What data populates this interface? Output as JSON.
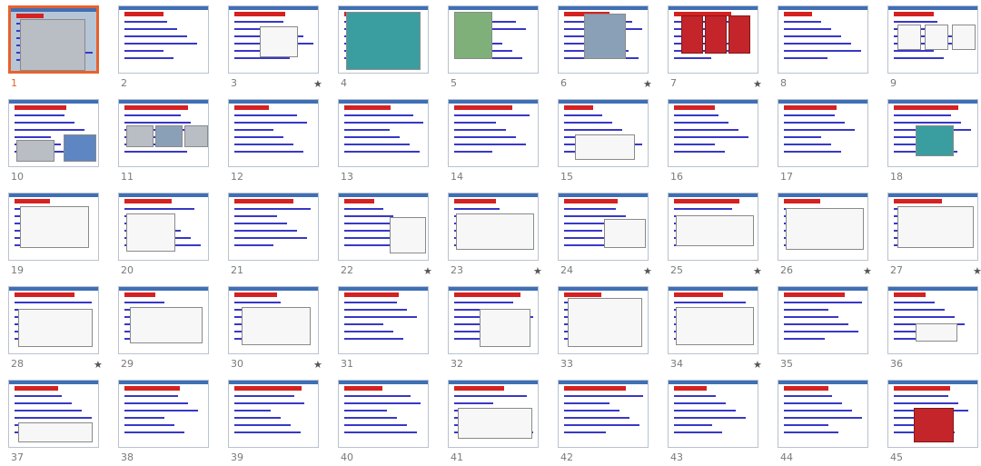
{
  "slides": [
    {
      "n": "1",
      "star": ""
    },
    {
      "n": "2",
      "star": ""
    },
    {
      "n": "3",
      "star": "★"
    },
    {
      "n": "4",
      "star": ""
    },
    {
      "n": "5",
      "star": ""
    },
    {
      "n": "6",
      "star": "★"
    },
    {
      "n": "7",
      "star": "★"
    },
    {
      "n": "8",
      "star": ""
    },
    {
      "n": "9",
      "star": ""
    },
    {
      "n": "10",
      "star": ""
    },
    {
      "n": "11",
      "star": ""
    },
    {
      "n": "12",
      "star": ""
    },
    {
      "n": "13",
      "star": ""
    },
    {
      "n": "14",
      "star": ""
    },
    {
      "n": "15",
      "star": ""
    },
    {
      "n": "16",
      "star": ""
    },
    {
      "n": "17",
      "star": ""
    },
    {
      "n": "18",
      "star": ""
    },
    {
      "n": "19",
      "star": ""
    },
    {
      "n": "20",
      "star": ""
    },
    {
      "n": "21",
      "star": ""
    },
    {
      "n": "22",
      "star": "★"
    },
    {
      "n": "23",
      "star": "★"
    },
    {
      "n": "24",
      "star": "★"
    },
    {
      "n": "25",
      "star": "★"
    },
    {
      "n": "26",
      "star": "★"
    },
    {
      "n": "27",
      "star": "★"
    },
    {
      "n": "28",
      "star": "★"
    },
    {
      "n": "29",
      "star": ""
    },
    {
      "n": "30",
      "star": "★"
    },
    {
      "n": "31",
      "star": ""
    },
    {
      "n": "32",
      "star": ""
    },
    {
      "n": "33",
      "star": ""
    },
    {
      "n": "34",
      "star": "★"
    },
    {
      "n": "35",
      "star": ""
    },
    {
      "n": "36",
      "star": ""
    },
    {
      "n": "37",
      "star": ""
    },
    {
      "n": "38",
      "star": ""
    },
    {
      "n": "39",
      "star": ""
    },
    {
      "n": "40",
      "star": ""
    },
    {
      "n": "41",
      "star": ""
    },
    {
      "n": "42",
      "star": ""
    },
    {
      "n": "43",
      "star": ""
    },
    {
      "n": "44",
      "star": ""
    },
    {
      "n": "45",
      "star": ""
    }
  ],
  "selected_slide": "1",
  "colors": {
    "selection": "#e8612c",
    "slide_border": "#b9c2cf",
    "header_bar": "#3f6fb5",
    "title_red": "#d62121",
    "body_text": "#3838c8"
  }
}
